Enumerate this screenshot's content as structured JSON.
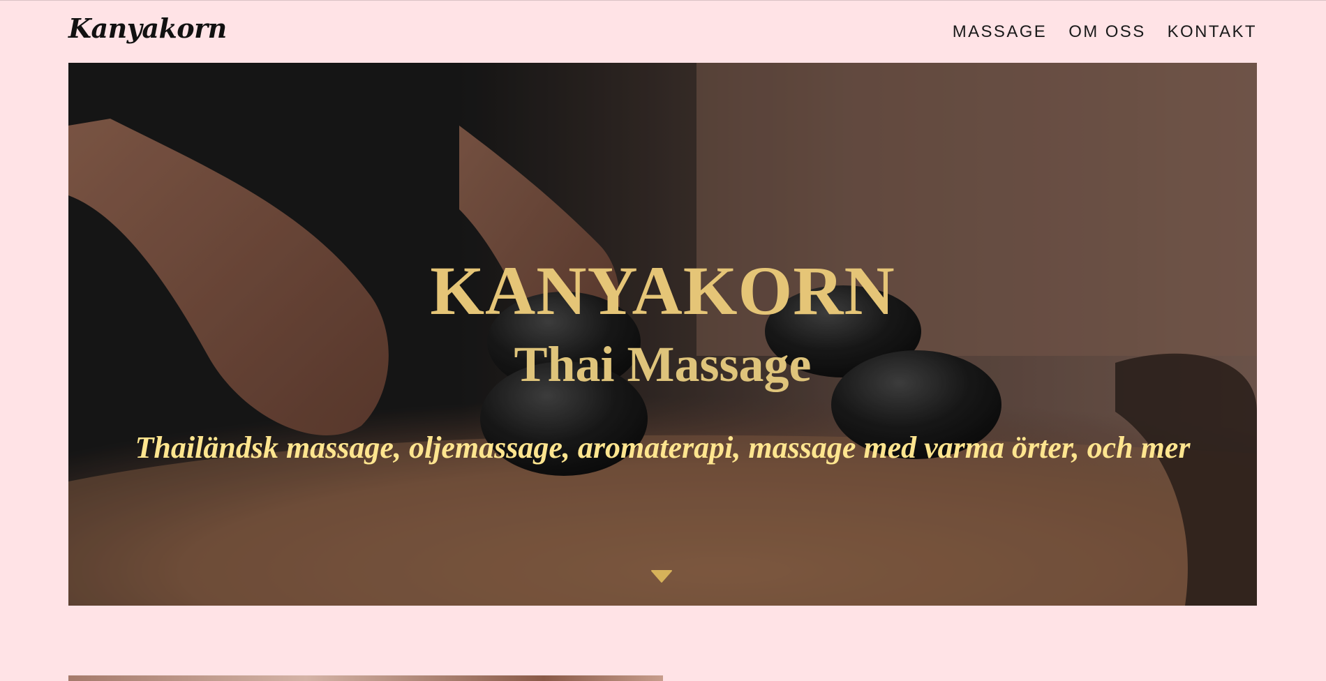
{
  "header": {
    "logo": "Kanyakorn",
    "nav": [
      {
        "label": "MASSAGE"
      },
      {
        "label": "OM OSS"
      },
      {
        "label": "KONTAKT"
      }
    ]
  },
  "hero": {
    "title": "KANYAKORN",
    "subtitle": "Thai Massage",
    "tagline": "Thailändsk massage, oljemassage, aromaterapi, massage med varma örter, och mer",
    "scroll_icon": "chevron-down-icon"
  },
  "colors": {
    "background": "#ffe3e6",
    "gold": "#e5c577",
    "tagline": "#ffe58f",
    "text": "#1a1a1a"
  }
}
